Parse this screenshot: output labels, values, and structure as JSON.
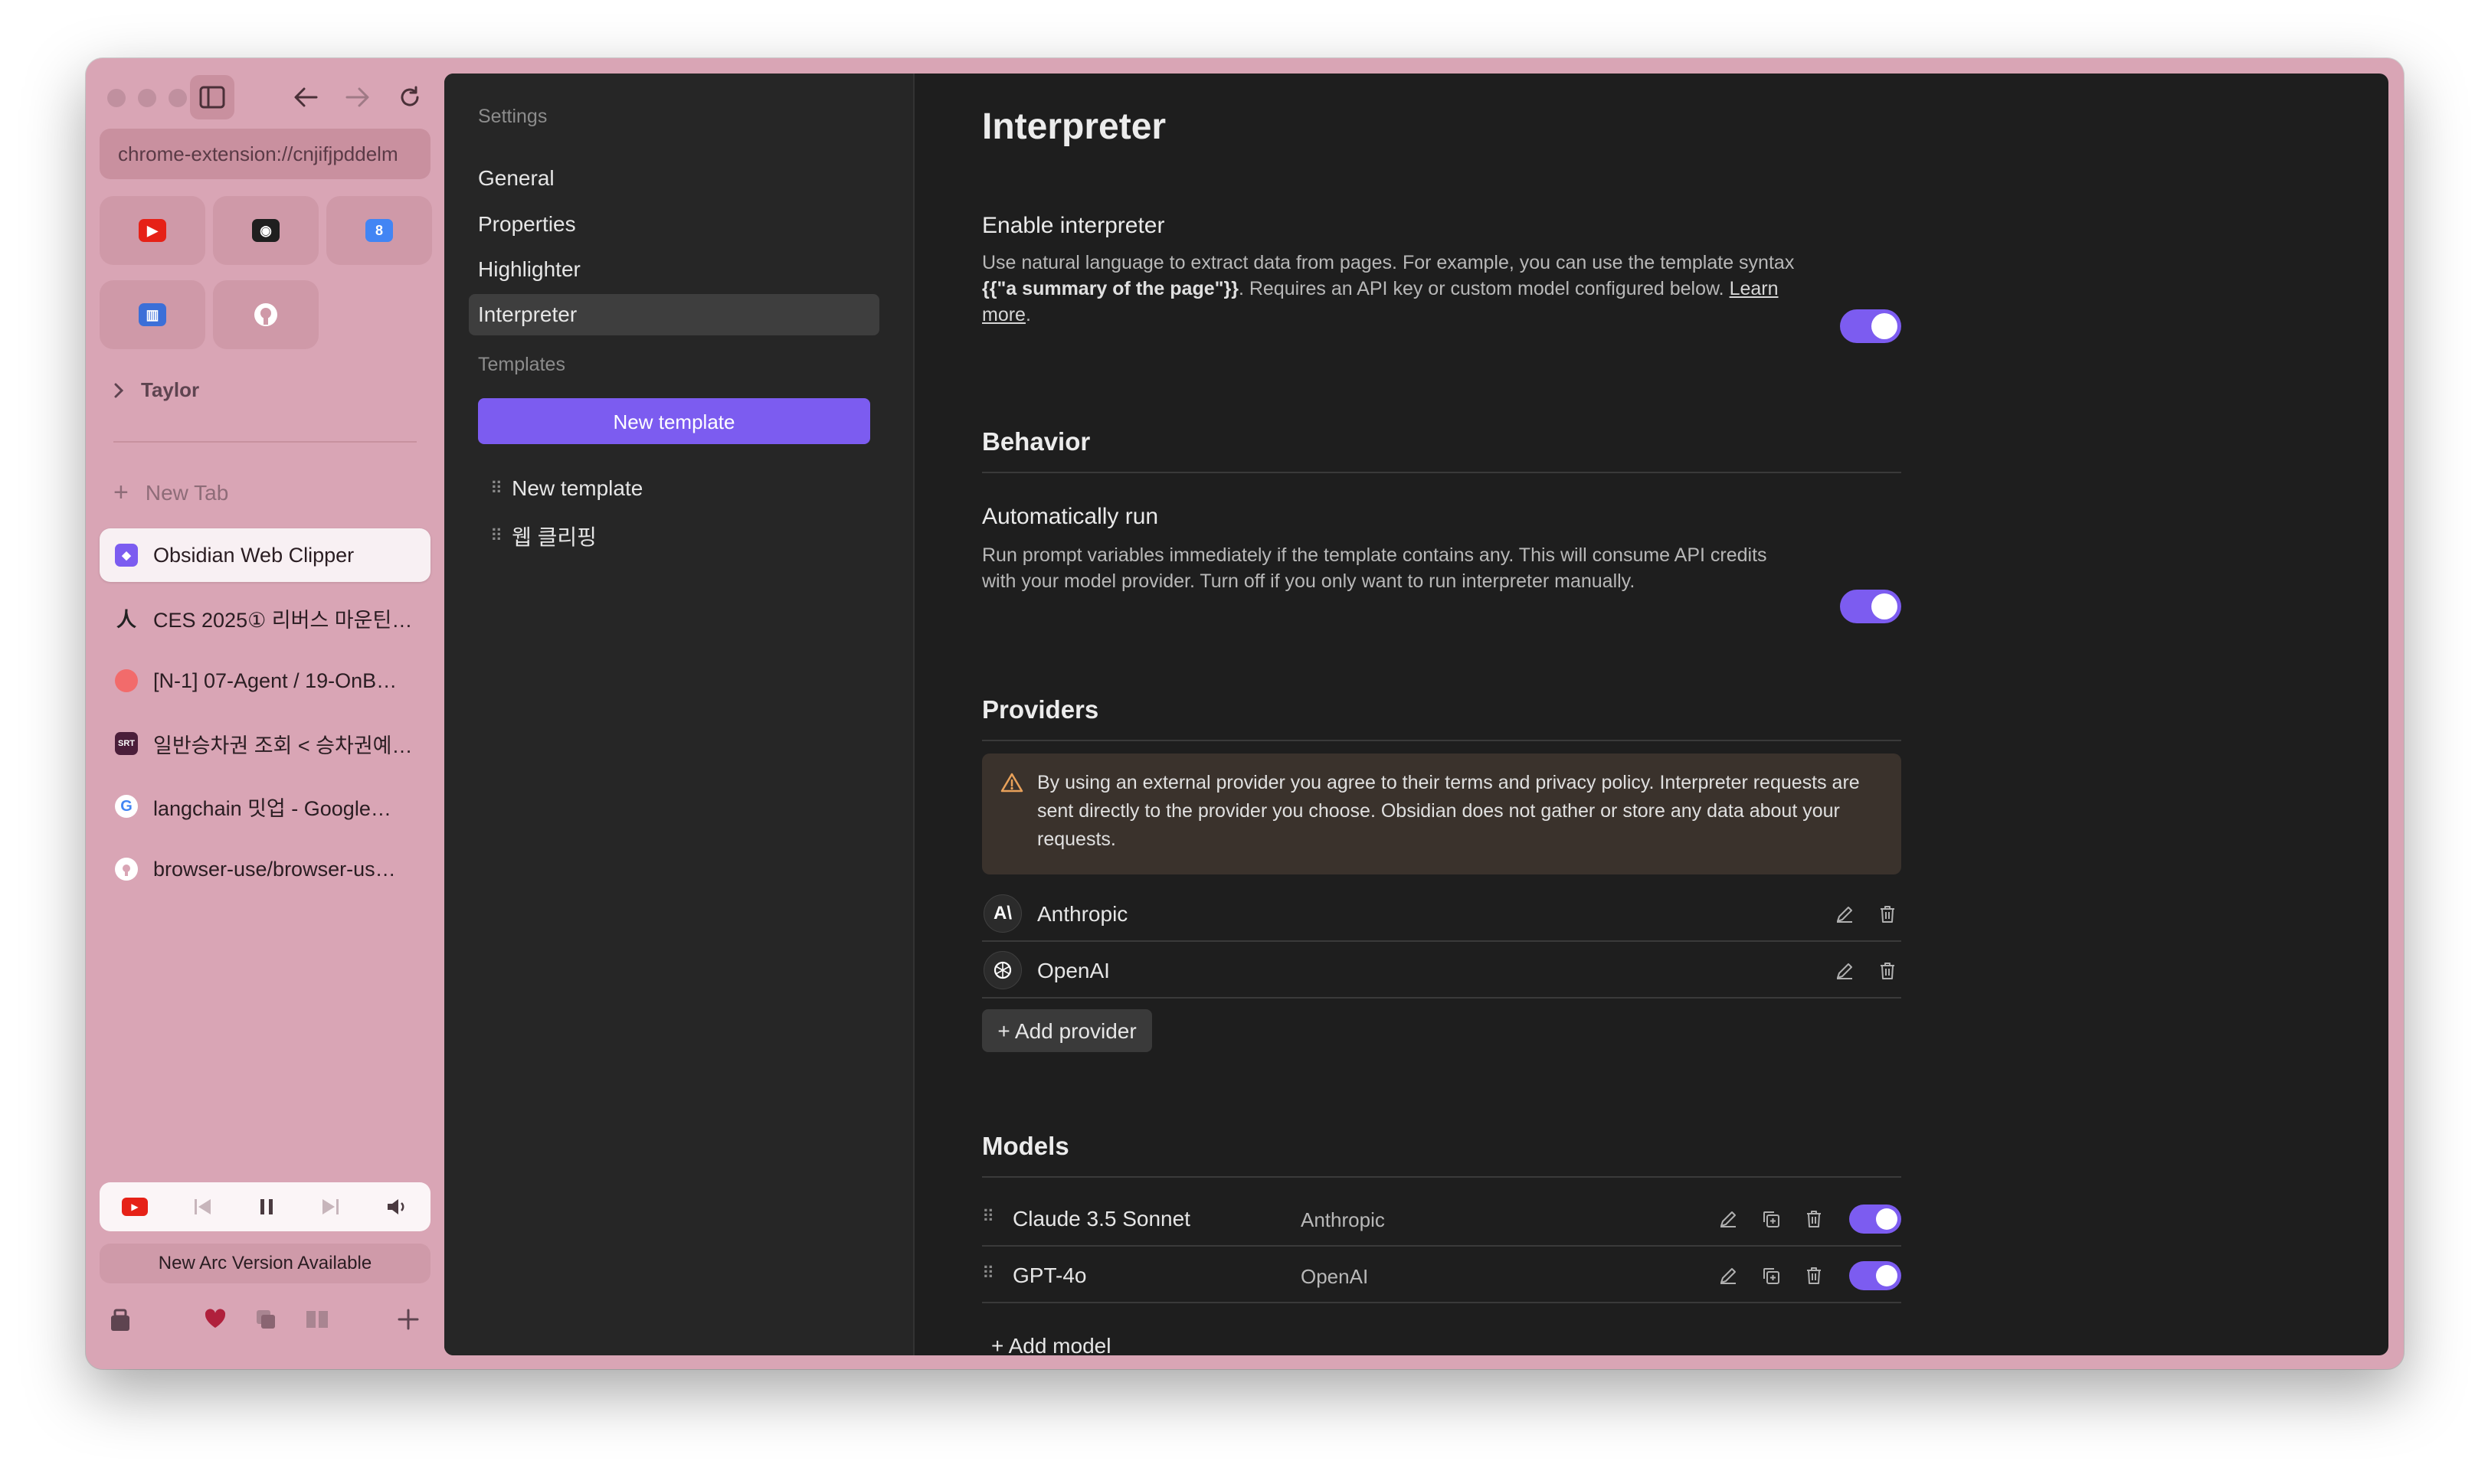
{
  "browser": {
    "url": "chrome-extension://cnjifjpddelm",
    "folder": "Taylor",
    "new_tab": "New Tab",
    "tabs": [
      {
        "title": "Obsidian Web Clipper",
        "active": true
      },
      {
        "title": "CES 2025① 리버스 마운틴…",
        "active": false
      },
      {
        "title": "[N-1] 07-Agent / 19-OnB…",
        "active": false
      },
      {
        "title": "일반승차권 조회 < 승차권예…",
        "active": false
      },
      {
        "title": "langchain 밋업 - Google…",
        "active": false
      },
      {
        "title": "browser-use/browser-us…",
        "active": false
      }
    ],
    "update_notice": "New Arc Version Available"
  },
  "settings_nav": {
    "settings_heading": "Settings",
    "items": [
      "General",
      "Properties",
      "Highlighter",
      "Interpreter"
    ],
    "selected": "Interpreter",
    "templates_heading": "Templates",
    "new_template_button": "New template",
    "templates": [
      "New template",
      "웹 클리핑"
    ]
  },
  "page": {
    "title": "Interpreter",
    "enable": {
      "title": "Enable interpreter",
      "desc_1": "Use natural language to extract data from pages. For example, you can use the template syntax ",
      "desc_code": "{{\"a summary of the page\"}}",
      "desc_2": ". Requires an API key or custom model configured below. ",
      "learn_more": "Learn more",
      "desc_end": ".",
      "on": true
    },
    "behavior": {
      "heading": "Behavior",
      "auto_run_title": "Automatically run",
      "auto_run_desc": "Run prompt variables immediately if the template contains any. This will consume API credits with your model provider. Turn off if you only want to run interpreter manually.",
      "on": true
    },
    "providers": {
      "heading": "Providers",
      "notice": "By using an external provider you agree to their terms and privacy policy. Interpreter requests are sent directly to the provider you choose. Obsidian does not gather or store any data about your requests.",
      "items": [
        {
          "name": "Anthropic",
          "icon": "anthropic-logo"
        },
        {
          "name": "OpenAI",
          "icon": "openai-logo"
        }
      ],
      "add_button": "+ Add provider"
    },
    "models": {
      "heading": "Models",
      "items": [
        {
          "name": "Claude 3.5 Sonnet",
          "provider": "Anthropic",
          "enabled": true
        },
        {
          "name": "GPT-4o",
          "provider": "OpenAI",
          "enabled": true
        }
      ],
      "add_button": "+ Add model"
    }
  },
  "colors": {
    "accent": "#7c5cf0",
    "sidebar_bg": "#d9a5b5",
    "pane_bg": "#1e1e1e",
    "nav_bg": "#262626"
  }
}
